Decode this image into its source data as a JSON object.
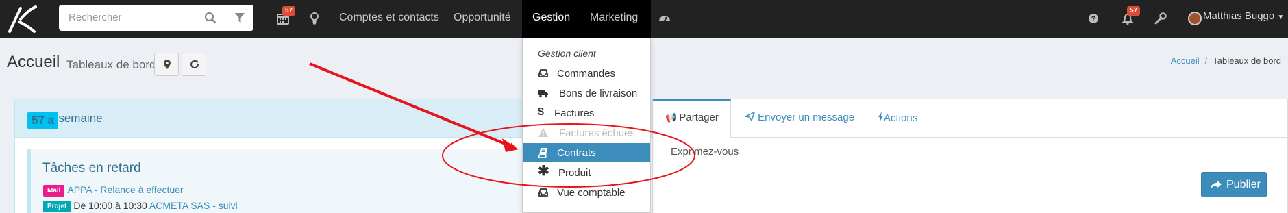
{
  "search": {
    "placeholder": "Rechercher"
  },
  "nav": {
    "calendar_badge": "57",
    "links": [
      "Comptes et contacts",
      "Opportunité",
      "Gestion",
      "Marketing"
    ],
    "notifications_badge": "57",
    "user_name": "Matthias Buggo"
  },
  "header": {
    "title": "Accueil",
    "subtitle": "Tableaux de bord",
    "breadcrumb": [
      "Accueil",
      "Tableaux de bord"
    ]
  },
  "week_box": {
    "title": "Cette semaine",
    "badge": "57 a"
  },
  "tasks": {
    "title": "Tâches en retard",
    "rows": [
      {
        "label": "Mail",
        "label_color": "#e91e8c",
        "pre": "",
        "link": "APPA - Relance à effectuer"
      },
      {
        "label": "Projet",
        "label_color": "#00a7b5",
        "pre": "De 10:00 à 10:30",
        "link": "ACMETA SAS - suivi"
      }
    ]
  },
  "panel": {
    "tabs": [
      "Partager",
      "Envoyer un message",
      "Actions"
    ],
    "placeholder": "Exprimez-vous",
    "publish": "Publier"
  },
  "dropdown": {
    "header": "Gestion client",
    "items": [
      {
        "label": "Commandes",
        "icon": "inbox-icon",
        "state": "normal"
      },
      {
        "label": "Bons de livraison",
        "icon": "truck-icon",
        "state": "normal"
      },
      {
        "label": "Factures",
        "icon": "dollar-icon",
        "state": "normal"
      },
      {
        "label": "Factures échues",
        "icon": "warning-icon",
        "state": "disabled"
      },
      {
        "label": "Contrats",
        "icon": "book-icon",
        "state": "selected"
      },
      {
        "label": "Produit",
        "icon": "asterisk-icon",
        "state": "normal"
      },
      {
        "label": "Vue comptable",
        "icon": "inbox-icon",
        "state": "normal"
      }
    ]
  },
  "colors": {
    "navbar": "#222222",
    "accent": "#3c8dbc",
    "badge": "#dd4b39",
    "annotation": "#e8141b"
  }
}
